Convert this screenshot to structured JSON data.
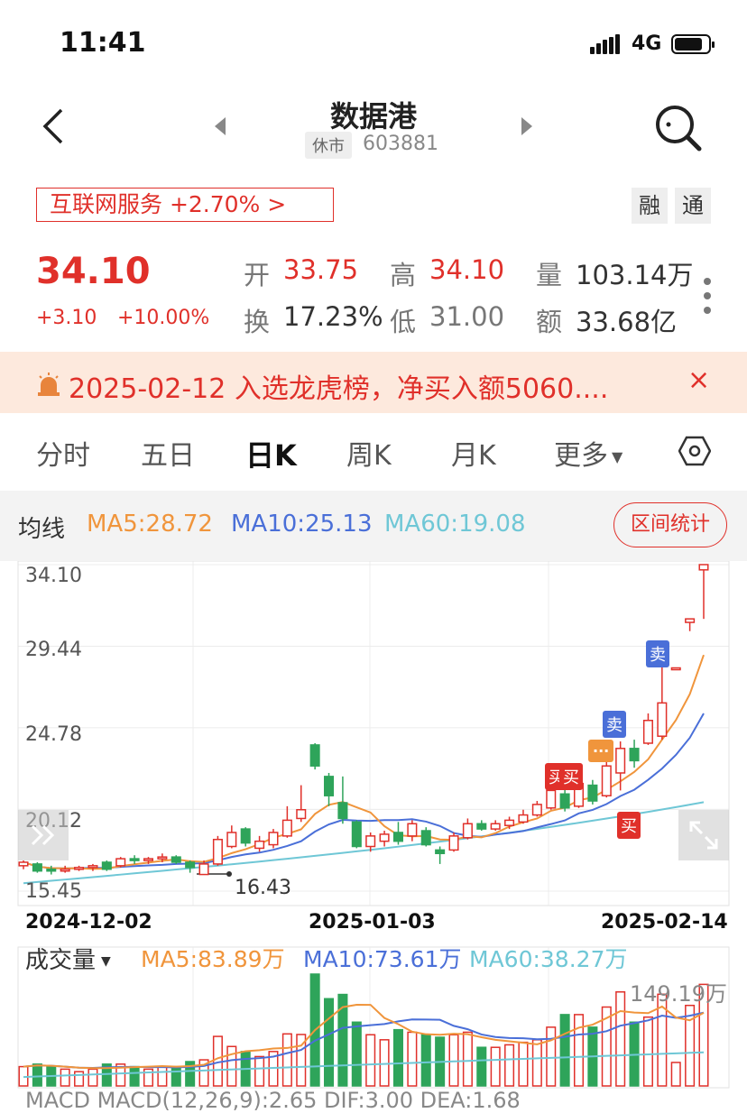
{
  "status_bar": {
    "time": "11:41",
    "network": "4G"
  },
  "header": {
    "title": "数据港",
    "status": "休市",
    "code": "603881"
  },
  "sector": {
    "label": "互联网服务 +2.70% >",
    "tags": [
      "融",
      "通"
    ]
  },
  "quote": {
    "price": "34.10",
    "change": "+3.10",
    "change_pct": "+10.00%",
    "open_label": "开",
    "open": "33.75",
    "high_label": "高",
    "high": "34.10",
    "volume_label": "量",
    "volume": "103.14万",
    "turnover_label": "换",
    "turnover": "17.23%",
    "low_label": "低",
    "low": "31.00",
    "amount_label": "额",
    "amount": "33.68亿"
  },
  "notice": {
    "text": "2025-02-12 入选龙虎榜，净买入额5060....",
    "close": "×"
  },
  "tabs": [
    "分时",
    "五日",
    "日K",
    "周K",
    "月K",
    "更多"
  ],
  "ma": {
    "label": "均线",
    "ma5": "MA5:28.72",
    "ma10": "MA10:25.13",
    "ma60": "MA60:19.08",
    "range_button": "区间统计"
  },
  "kline": {
    "y_ticks": [
      "34.10",
      "29.44",
      "24.78",
      "20.12",
      "15.45"
    ],
    "low_marker": "16.43",
    "dates": [
      "2024-12-02",
      "2025-01-03",
      "2025-02-14"
    ],
    "signals": {
      "buy": "买",
      "sell": "卖",
      "more": "···"
    }
  },
  "volume": {
    "label": "成交量",
    "ma5": "MA5:83.89万",
    "ma10": "MA10:73.61万",
    "ma60": "MA60:38.27万",
    "max": "149.19万"
  },
  "macd": {
    "text": "MACD   MACD(12,26,9):2.65   DIF:3.00   DEA:1.68"
  },
  "colors": {
    "up": "#e0302a",
    "down": "#2ea45a",
    "ma5": "#f0953c",
    "ma10": "#4a6fd8",
    "ma60": "#6fc7d6"
  },
  "chart_data": {
    "type": "candlestick",
    "title": "",
    "ylim": [
      15.45,
      34.1
    ],
    "candles": [
      {
        "o": 16.9,
        "c": 17.1,
        "h": 17.2,
        "l": 16.7
      },
      {
        "o": 17.0,
        "c": 16.6,
        "h": 17.1,
        "l": 16.5
      },
      {
        "o": 16.7,
        "c": 16.6,
        "h": 16.9,
        "l": 16.4
      },
      {
        "o": 16.6,
        "c": 16.7,
        "h": 16.9,
        "l": 16.5
      },
      {
        "o": 16.7,
        "c": 16.8,
        "h": 16.9,
        "l": 16.6
      },
      {
        "o": 16.8,
        "c": 16.9,
        "h": 17.0,
        "l": 16.6
      },
      {
        "o": 17.1,
        "c": 16.7,
        "h": 17.2,
        "l": 16.6
      },
      {
        "o": 16.9,
        "c": 17.3,
        "h": 17.4,
        "l": 16.8
      },
      {
        "o": 17.3,
        "c": 17.2,
        "h": 17.5,
        "l": 17.0
      },
      {
        "o": 17.2,
        "c": 17.3,
        "h": 17.4,
        "l": 17.0
      },
      {
        "o": 17.3,
        "c": 17.4,
        "h": 17.6,
        "l": 17.1
      },
      {
        "o": 17.4,
        "c": 17.1,
        "h": 17.5,
        "l": 17.0
      },
      {
        "o": 17.1,
        "c": 16.8,
        "h": 17.2,
        "l": 16.5
      },
      {
        "o": 16.4,
        "c": 17.0,
        "h": 17.2,
        "l": 16.43
      },
      {
        "o": 17.0,
        "c": 18.4,
        "h": 18.6,
        "l": 16.9
      },
      {
        "o": 18.0,
        "c": 18.8,
        "h": 19.2,
        "l": 17.9
      },
      {
        "o": 19.0,
        "c": 18.2,
        "h": 19.1,
        "l": 18.0
      },
      {
        "o": 17.9,
        "c": 18.3,
        "h": 18.6,
        "l": 17.7
      },
      {
        "o": 18.1,
        "c": 18.8,
        "h": 19.0,
        "l": 17.9
      },
      {
        "o": 18.6,
        "c": 19.5,
        "h": 20.3,
        "l": 18.5
      },
      {
        "o": 19.6,
        "c": 20.1,
        "h": 21.5,
        "l": 19.4
      },
      {
        "o": 23.8,
        "c": 22.6,
        "h": 23.9,
        "l": 22.4
      },
      {
        "o": 22.0,
        "c": 20.9,
        "h": 22.2,
        "l": 20.3
      },
      {
        "o": 20.5,
        "c": 19.6,
        "h": 22.0,
        "l": 19.3
      },
      {
        "o": 19.4,
        "c": 18.0,
        "h": 19.5,
        "l": 17.9
      },
      {
        "o": 18.0,
        "c": 18.6,
        "h": 18.8,
        "l": 17.7
      },
      {
        "o": 18.3,
        "c": 18.7,
        "h": 18.9,
        "l": 18.0
      },
      {
        "o": 18.8,
        "c": 18.3,
        "h": 19.4,
        "l": 18.1
      },
      {
        "o": 18.6,
        "c": 19.3,
        "h": 19.5,
        "l": 18.3
      },
      {
        "o": 18.9,
        "c": 18.1,
        "h": 19.1,
        "l": 18.0
      },
      {
        "o": 17.8,
        "c": 17.6,
        "h": 18.0,
        "l": 17.0
      },
      {
        "o": 17.8,
        "c": 18.6,
        "h": 18.8,
        "l": 17.7
      },
      {
        "o": 18.5,
        "c": 19.3,
        "h": 19.6,
        "l": 18.4
      },
      {
        "o": 19.3,
        "c": 19.0,
        "h": 19.5,
        "l": 18.9
      },
      {
        "o": 19.0,
        "c": 19.3,
        "h": 19.5,
        "l": 18.9
      },
      {
        "o": 19.2,
        "c": 19.5,
        "h": 19.7,
        "l": 19.0
      },
      {
        "o": 19.4,
        "c": 19.8,
        "h": 20.1,
        "l": 19.3
      },
      {
        "o": 19.8,
        "c": 20.4,
        "h": 20.6,
        "l": 19.7
      },
      {
        "o": 20.2,
        "c": 21.2,
        "h": 21.5,
        "l": 20.1
      },
      {
        "o": 21.0,
        "c": 20.2,
        "h": 21.9,
        "l": 20.0
      },
      {
        "o": 20.3,
        "c": 21.6,
        "h": 22.1,
        "l": 20.2
      },
      {
        "o": 21.5,
        "c": 20.6,
        "h": 21.8,
        "l": 20.4
      },
      {
        "o": 20.9,
        "c": 22.6,
        "h": 23.0,
        "l": 20.8
      },
      {
        "o": 22.2,
        "c": 23.6,
        "h": 24.0,
        "l": 21.2
      },
      {
        "o": 23.6,
        "c": 22.9,
        "h": 24.1,
        "l": 22.5
      },
      {
        "o": 23.9,
        "c": 25.2,
        "h": 25.6,
        "l": 23.8
      },
      {
        "o": 24.3,
        "c": 26.2,
        "h": 28.6,
        "l": 24.1
      },
      {
        "o": 28.2,
        "c": 28.2,
        "h": 28.2,
        "l": 28.2
      },
      {
        "o": 30.8,
        "c": 31.0,
        "h": 31.0,
        "l": 30.3
      },
      {
        "o": 33.8,
        "c": 34.1,
        "h": 34.1,
        "l": 31.0
      }
    ]
  }
}
